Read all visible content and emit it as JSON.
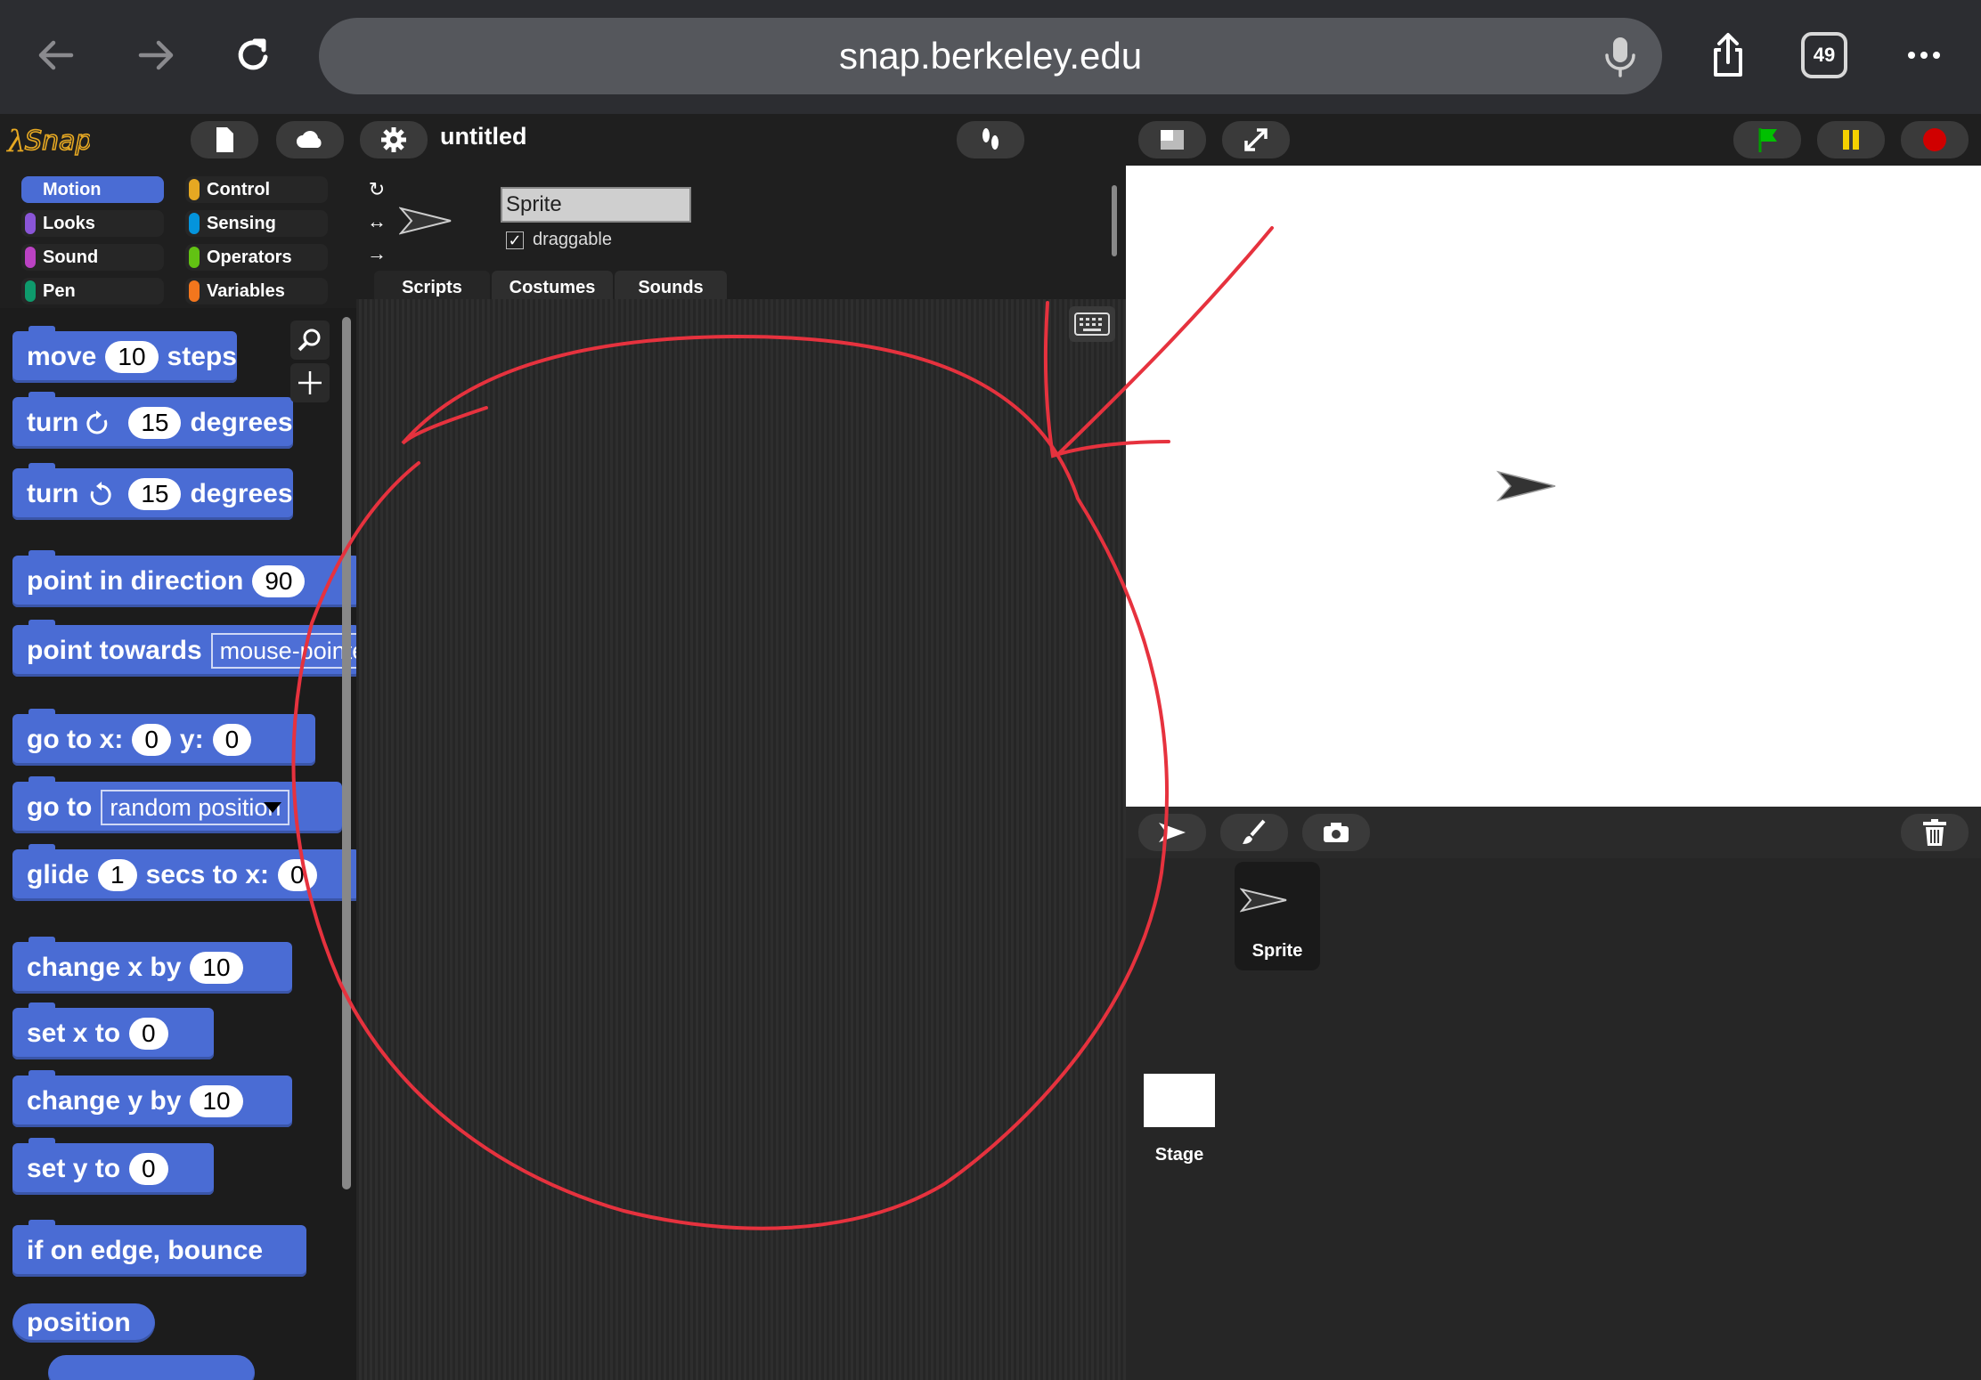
{
  "browser": {
    "url": "snap.berkeley.edu",
    "tab_count": "49"
  },
  "snap": {
    "project_title": "untitled",
    "categories": [
      {
        "label": "Motion",
        "color": "#4a6cd4",
        "selected": true
      },
      {
        "label": "Looks",
        "color": "#8a55d7",
        "selected": false
      },
      {
        "label": "Sound",
        "color": "#bb42c3",
        "selected": false
      },
      {
        "label": "Pen",
        "color": "#0e9a6c",
        "selected": false
      },
      {
        "label": "Control",
        "color": "#e6a822",
        "selected": false
      },
      {
        "label": "Sensing",
        "color": "#0494dc",
        "selected": false
      },
      {
        "label": "Operators",
        "color": "#62c213",
        "selected": false
      },
      {
        "label": "Variables",
        "color": "#f3761d",
        "selected": false
      }
    ],
    "blocks": {
      "move": {
        "pre": "move",
        "val": "10",
        "post": "steps"
      },
      "turn_cw": {
        "pre": "turn",
        "val": "15",
        "post": "degrees",
        "icon": "rotate-clockwise-icon"
      },
      "turn_ccw": {
        "pre": "turn",
        "val": "15",
        "post": "degrees",
        "icon": "rotate-counterclockwise-icon"
      },
      "point_dir": {
        "pre": "point in direction",
        "val": "90"
      },
      "point_towards": {
        "pre": "point towards",
        "val": "mouse-pointer"
      },
      "go_to_xy": {
        "pre": "go to x:",
        "x": "0",
        "mid": "y:",
        "y": "0"
      },
      "go_to": {
        "pre": "go to",
        "val": "random position"
      },
      "glide": {
        "pre": "glide",
        "val": "1",
        "post": "secs to x:",
        "x": "0"
      },
      "change_x": {
        "pre": "change x by",
        "val": "10"
      },
      "set_x": {
        "pre": "set x to",
        "val": "0"
      },
      "change_y": {
        "pre": "change y by",
        "val": "10"
      },
      "set_y": {
        "pre": "set y to",
        "val": "0"
      },
      "bounce": {
        "pre": "if on edge, bounce"
      },
      "position": {
        "pre": "position"
      }
    },
    "sprite": {
      "name": "Sprite",
      "draggable_label": "draggable",
      "draggable_checked": "✓"
    },
    "tabs": [
      "Scripts",
      "Costumes",
      "Sounds"
    ],
    "corral": {
      "sprite_label": "Sprite",
      "stage_label": "Stage"
    }
  }
}
